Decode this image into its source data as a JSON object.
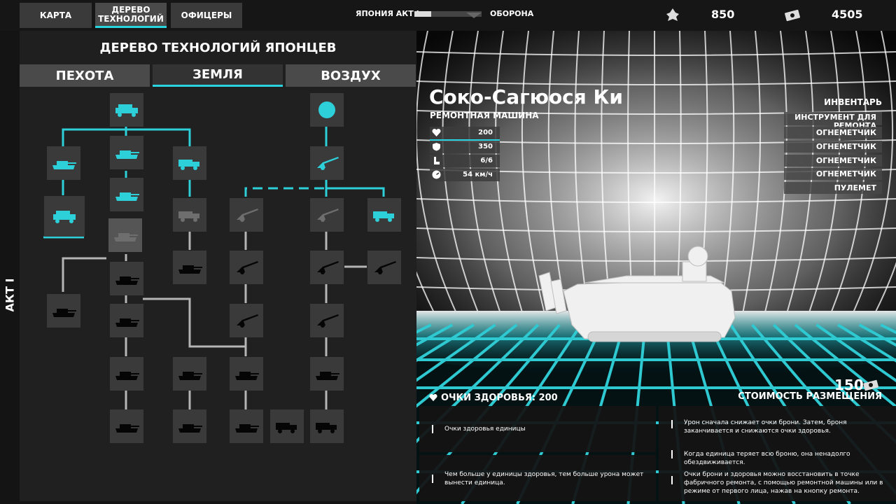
{
  "top_tabs": [
    {
      "label": "КАРТА"
    },
    {
      "label": "ДЕРЕВО\nТЕХНОЛОГИЙ"
    },
    {
      "label": "ОФИЦЕРЫ"
    }
  ],
  "act": {
    "label": "ЯПОНИЯ АКТ I",
    "mode": "ОБОРОНА",
    "progress": 0.25
  },
  "resources": {
    "manpower": "850",
    "money": "4505"
  },
  "tree": {
    "title": "ДЕРЕВО ТЕХНОЛОГИЙ ЯПОНЦЕВ",
    "categories": [
      {
        "label": "ПЕХОТА"
      },
      {
        "label": "ЗЕМЛЯ"
      },
      {
        "label": "ВОЗДУХ"
      }
    ],
    "act_label": "АКТ I"
  },
  "unit": {
    "name": "Соко-Сагюося Ки",
    "type": "РЕМОНТНАЯ МАШИНА",
    "stats": [
      {
        "icon": "heart-icon",
        "value": "200"
      },
      {
        "icon": "shield-icon",
        "value": "350"
      },
      {
        "icon": "seat-icon",
        "value": "6/6"
      },
      {
        "icon": "speedometer-icon",
        "value": "54 км/ч"
      }
    ],
    "inventory_title": "ИНВЕНТАРЬ",
    "inventory": [
      "ИНСТРУМЕНТ ДЛЯ РЕМОНТА",
      "ОГНЕМЕТЧИК",
      "ОГНЕМЕТЧИК",
      "ОГНЕМЕТЧИК",
      "ОГНЕМЕТЧИК",
      "ПУЛЕМЕТ"
    ],
    "cost": "150",
    "cost_label": "СТОИМОСТЬ РАЗМЕЩЕНИЯ"
  },
  "info": {
    "health_label": "ОЧКИ ЗДОРОВЬЯ: 200",
    "left": [
      "Очки здоровья единицы",
      "Чем больше у единицы здоровья, тем больше урона может вынести единица."
    ],
    "right": [
      "Урон сначала снижает очки брони. Затем, броня заканчивается и снижаются очки здоровья.",
      "Когда единица теряет всю броню, она ненадолго обездвиживается.",
      "Очки брони и здоровья можно восстановить в точке фабричного ремонта, с помощью ремонтной машины или в режиме от первого лица, нажав на кнопку ремонта."
    ]
  },
  "colors": {
    "accent": "#2ad4df"
  }
}
